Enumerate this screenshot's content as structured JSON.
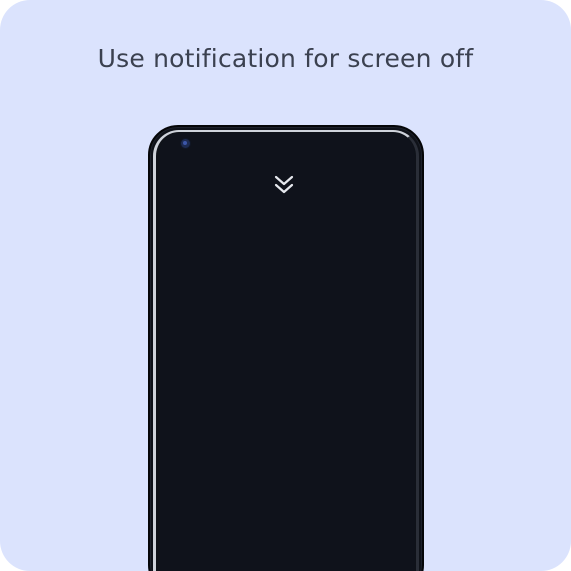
{
  "heading": {
    "title": "Use notification for screen off"
  },
  "phone": {
    "icon": "double-chevron-down-icon",
    "camera": "front-camera"
  },
  "colors": {
    "background": "#dbe3fd",
    "title_text": "#3b4150",
    "screen": "#0f121b",
    "icon": "#e6e8ee"
  }
}
